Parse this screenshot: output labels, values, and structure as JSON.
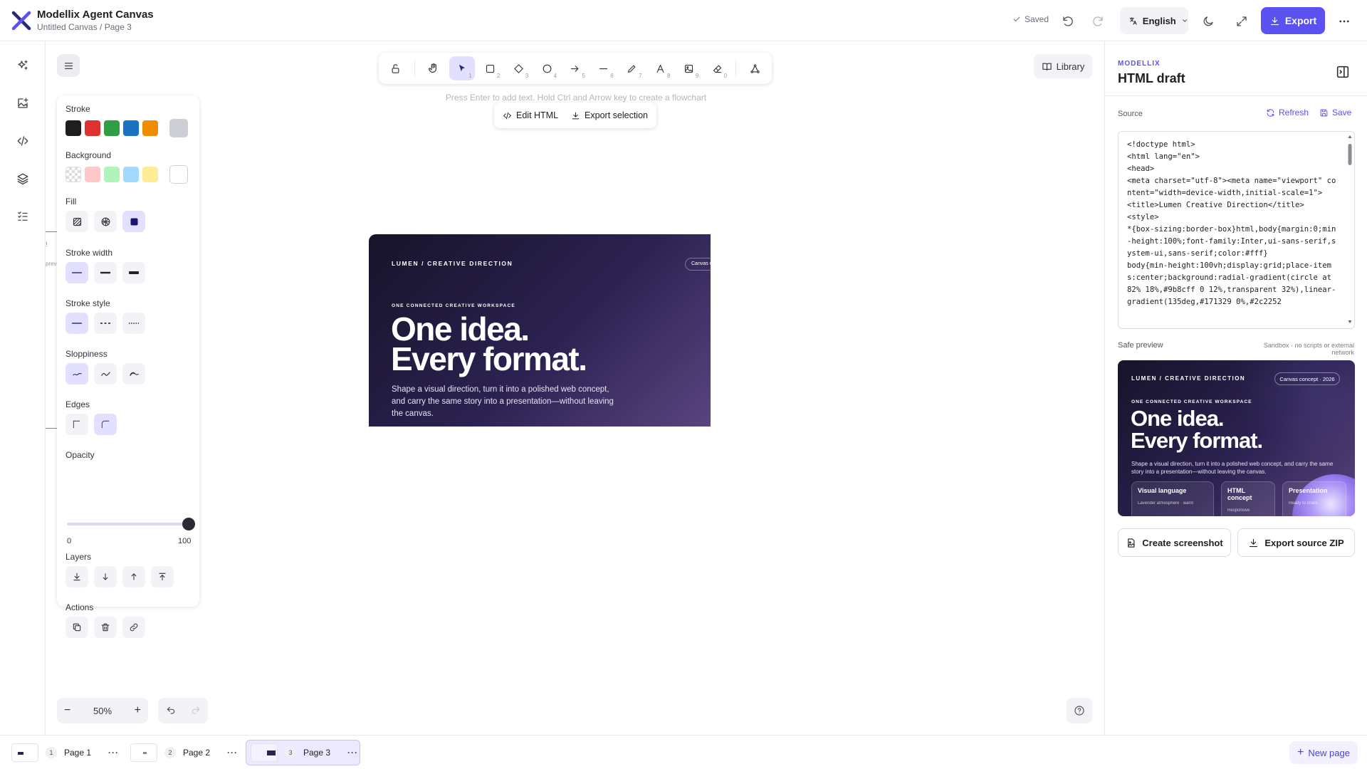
{
  "header": {
    "app_title": "Modellix Agent Canvas",
    "breadcrumb": "Untitled Canvas / Page 3",
    "saved_label": "Saved",
    "language": "English",
    "export_label": "Export"
  },
  "canvas": {
    "hint": "Press Enter to add text. Hold Ctrl and Arrow key to create a flowchart",
    "library_label": "Library",
    "tool_keys": [
      "1",
      "2",
      "3",
      "4",
      "5",
      "6",
      "7",
      "8",
      "9",
      "0"
    ],
    "selection_toolbar": {
      "edit_html": "Edit HTML",
      "export_selection": "Export selection"
    },
    "zoom": "50%"
  },
  "properties": {
    "stroke_label": "Stroke",
    "stroke_colors": [
      "#1e1e1e",
      "#e03131",
      "#2f9e44",
      "#1971c2",
      "#f08c00"
    ],
    "stroke_current": "#ceced6",
    "background_label": "Background",
    "background_colors": [
      "transparent",
      "#ffc9c9",
      "#b2f2bb",
      "#a5d8ff",
      "#ffec99"
    ],
    "background_current": "#ffffff",
    "fill_label": "Fill",
    "stroke_width_label": "Stroke width",
    "stroke_style_label": "Stroke style",
    "sloppiness_label": "Sloppiness",
    "edges_label": "Edges",
    "opacity_label": "Opacity",
    "opacity_min": "0",
    "opacity_max": "100",
    "opacity_value": 100,
    "layers_label": "Layers",
    "actions_label": "Actions"
  },
  "hero": {
    "brand": "LUMEN / CREATIVE DIRECTION",
    "chip": "Canvas co",
    "eyebrow": "ONE CONNECTED CREATIVE WORKSPACE",
    "headline_1": "One idea.",
    "headline_2": "Every format.",
    "lede": "Shape a visual direction, turn it into a polished web concept, and carry the same story into a presentation—without leaving the canvas."
  },
  "canvas_edge_text": {
    "left_char": "!",
    "left_word": "previ"
  },
  "panel": {
    "brand": "MODELLIX",
    "title": "HTML draft",
    "source_label": "Source",
    "refresh_label": "Refresh",
    "save_label": "Save",
    "source_code": "<!doctype html>\n<html lang=\"en\">\n<head>\n<meta charset=\"utf-8\"><meta name=\"viewport\" content=\"width=device-width,initial-scale=1\">\n<title>Lumen Creative Direction</title>\n<style>\n*{box-sizing:border-box}html,body{margin:0;min-height:100%;font-family:Inter,ui-sans-serif,system-ui,sans-serif;color:#fff}\nbody{min-height:100vh;display:grid;place-items:center;background:radial-gradient(circle at 82% 18%,#9b8cff 0 12%,transparent 32%),linear-gradient(135deg,#171329 0%,#2c2252",
    "preview_label": "Safe preview",
    "preview_note": "Sandbox · no scripts or external network",
    "preview": {
      "brand": "LUMEN / CREATIVE DIRECTION",
      "chip": "Canvas concept · 2026",
      "eyebrow": "ONE CONNECTED CREATIVE WORKSPACE",
      "headline_1": "One idea.",
      "headline_2": "Every format.",
      "lede": "Shape a visual direction, turn it into a polished web concept, and carry the same story into a presentation—without leaving the canvas.",
      "cards": [
        {
          "title": "Visual language",
          "sub": "Lavender atmosphere · warm"
        },
        {
          "title": "HTML concept",
          "sub": "Responsive"
        },
        {
          "title": "Presentation",
          "sub": "Ready to share"
        }
      ]
    },
    "screenshot_label": "Create screenshot",
    "zip_label": "Export source ZIP"
  },
  "pages": [
    {
      "num": "1",
      "label": "Page 1"
    },
    {
      "num": "2",
      "label": "Page 2"
    },
    {
      "num": "3",
      "label": "Page 3"
    }
  ],
  "new_page_label": "New page",
  "colors": {
    "accent": "#5b50f0",
    "accent_soft": "#e3e0ff"
  }
}
